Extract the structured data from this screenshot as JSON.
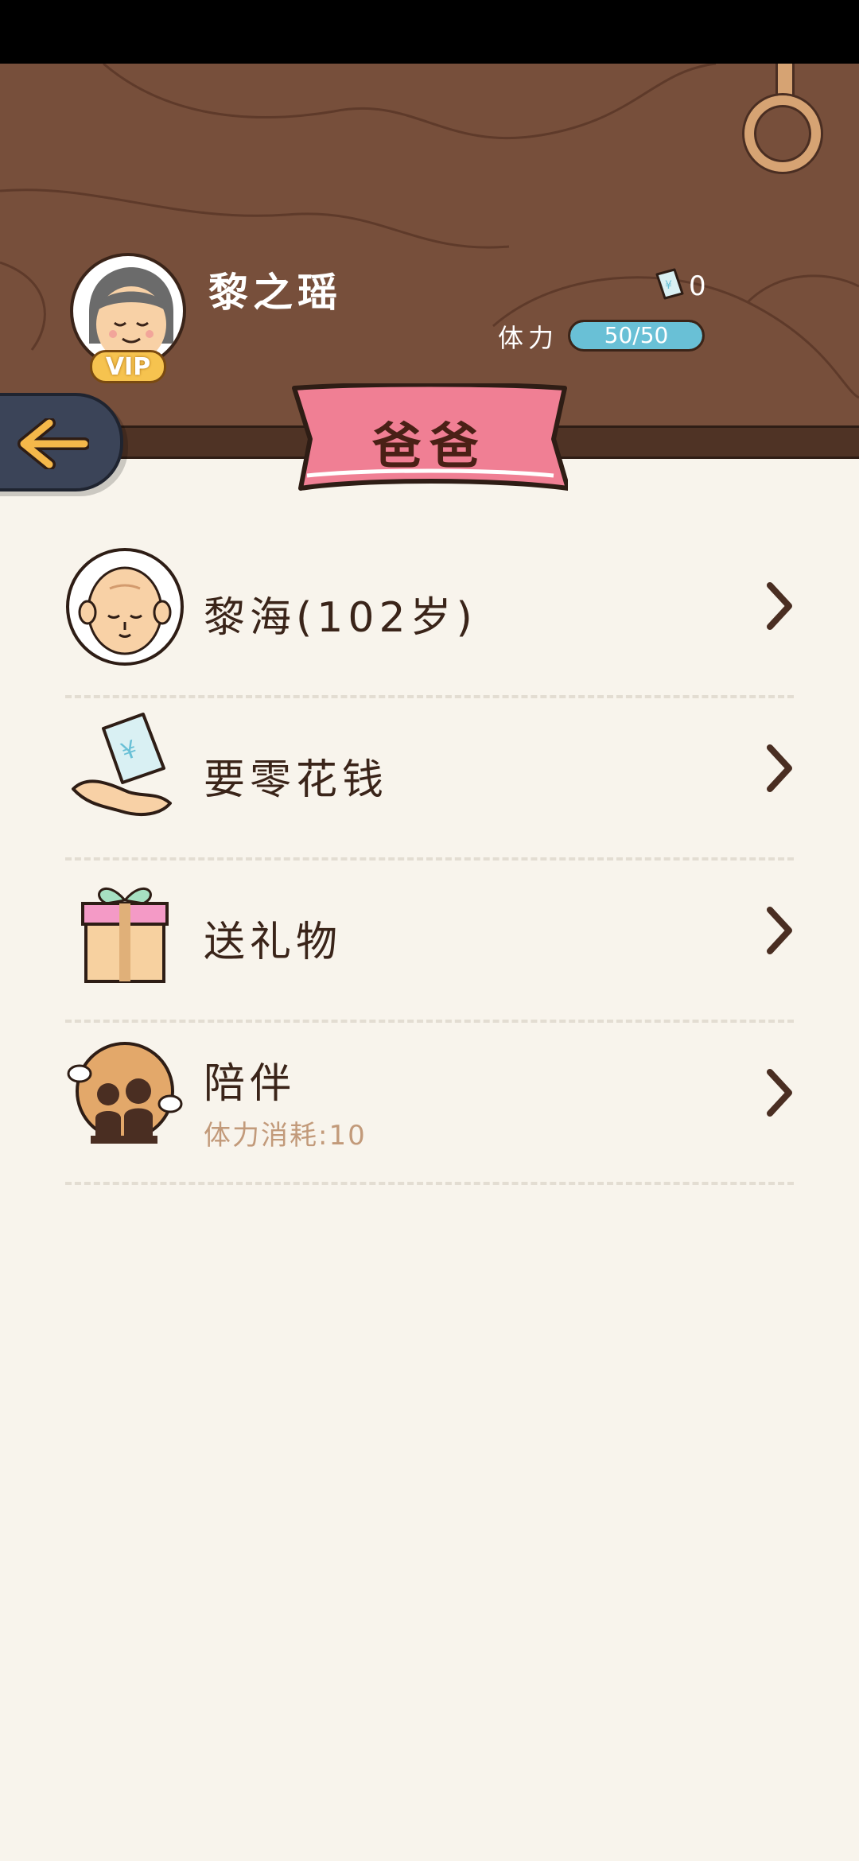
{
  "user": {
    "name": "黎之瑶",
    "vip_label": "VIP",
    "coupon_count": "0",
    "stamina_label": "体力",
    "stamina_text": "50/50",
    "stamina_fraction": 1.0
  },
  "page_title": "爸爸",
  "menu": {
    "items": [
      {
        "label": "黎海(102岁)",
        "icon": "old-man-avatar-icon"
      },
      {
        "label": "要零花钱",
        "icon": "money-in-hand-icon"
      },
      {
        "label": "送礼物",
        "icon": "gift-box-icon"
      },
      {
        "label": "陪伴",
        "sub": "体力消耗:10",
        "icon": "companionship-icon"
      }
    ]
  },
  "colors": {
    "header_wood": "#774f3b",
    "ribbon_pink": "#f07f94",
    "stamina_blue": "#69c0d6",
    "page_bg": "#f8f4ec",
    "back_button": "#3b4458"
  }
}
